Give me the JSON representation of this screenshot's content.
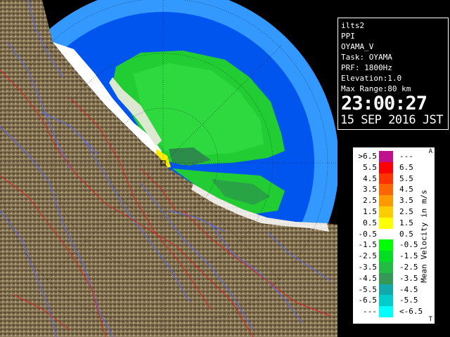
{
  "info": {
    "lines": [
      "ilts2",
      "PPI",
      "OYAMA_V",
      "Task: OYAMA",
      "PRF: 1800Hz",
      "Elevation:1.0",
      "Max Range:80 km"
    ],
    "time": "23:00:27",
    "date": "15 SEP 2016 JST"
  },
  "legend": {
    "title": "Mean Velocity in m/s",
    "corner_top": "A",
    "corner_bottom": "T",
    "rows": [
      {
        "lo": ">6.5",
        "hi": "---",
        "color": "#c0108c"
      },
      {
        "lo": "5.5",
        "hi": "6.5",
        "color": "#ff0000"
      },
      {
        "lo": "4.5",
        "hi": "5.5",
        "color": "#ff3300"
      },
      {
        "lo": "3.5",
        "hi": "4.5",
        "color": "#ff6600"
      },
      {
        "lo": "2.5",
        "hi": "3.5",
        "color": "#ff9900"
      },
      {
        "lo": "1.5",
        "hi": "2.5",
        "color": "#ffcc00"
      },
      {
        "lo": "0.5",
        "hi": "1.5",
        "color": "#ffff00"
      },
      {
        "lo": "-0.5",
        "hi": "0.5",
        "color": "#ffffff"
      },
      {
        "lo": "-1.5",
        "hi": "-0.5",
        "color": "#00ff00"
      },
      {
        "lo": "-2.5",
        "hi": "-1.5",
        "color": "#00dd22"
      },
      {
        "lo": "-3.5",
        "hi": "-2.5",
        "color": "#22bb44"
      },
      {
        "lo": "-4.5",
        "hi": "-3.5",
        "color": "#339955"
      },
      {
        "lo": "-5.5",
        "hi": "-4.5",
        "color": "#11aaaa"
      },
      {
        "lo": "-6.5",
        "hi": "-5.5",
        "color": "#00cccc"
      },
      {
        "lo": "---",
        "hi": "<-6.5",
        "color": "#00ffff"
      }
    ]
  },
  "colors": {
    "background": "#000000",
    "radar_range": "#0055ee",
    "outer_range": "#3399ff",
    "terrain": "#7a6a4e",
    "rivers": "#5566ff",
    "boundaries": "#dd2222"
  }
}
